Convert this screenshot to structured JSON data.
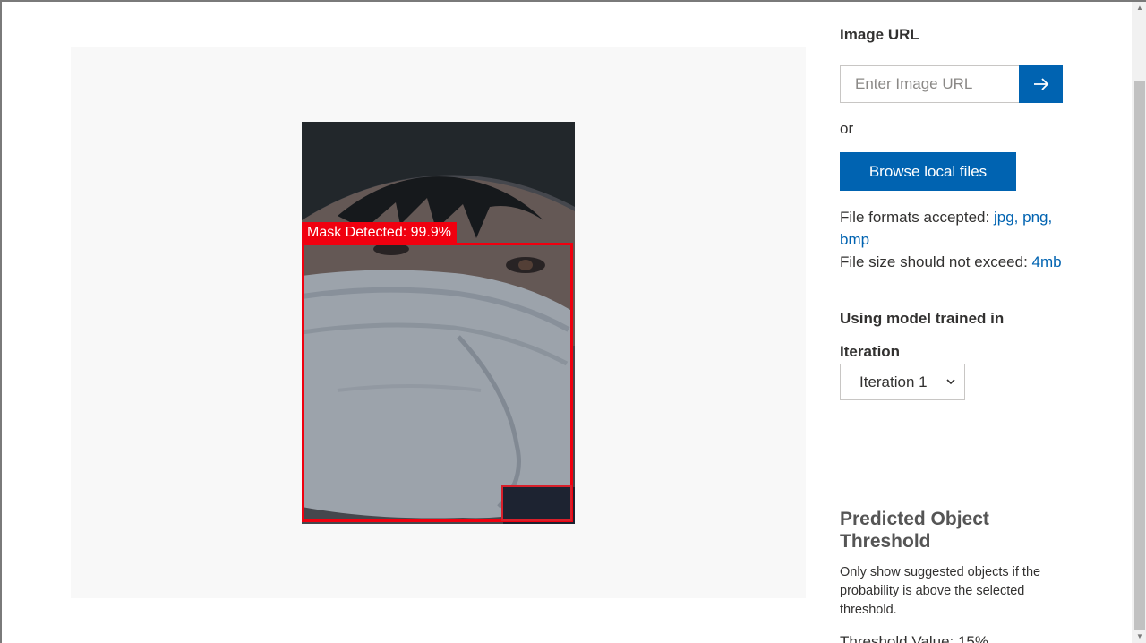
{
  "preview": {
    "detection_label": "Mask Detected: 99.9%",
    "detection_probability": 99.9
  },
  "side": {
    "image_url_title": "Image URL",
    "url_placeholder": "Enter Image URL",
    "go_icon": "arrow-right-icon",
    "or_text": "or",
    "browse_label": "Browse local files",
    "formats_prefix": "File formats accepted:",
    "formats_value": "jpg, png, bmp",
    "size_prefix": "File size should not exceed:",
    "size_value": "4mb",
    "model_title": "Using model trained in",
    "iteration_title": "Iteration",
    "iteration_selected": "Iteration 1",
    "threshold_title": "Predicted Object Threshold",
    "threshold_desc": "Only show suggested objects if the probability is above the selected threshold.",
    "threshold_value_text": "Threshold Value: 15%"
  },
  "colors": {
    "accent": "#0063b1",
    "detection": "#f0000f",
    "panel_bg": "#f8f8f8"
  }
}
